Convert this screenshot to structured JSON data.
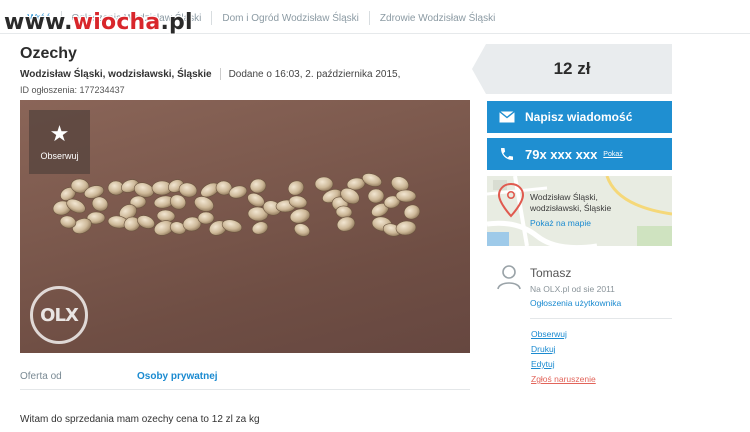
{
  "watermark": {
    "prefix": "www.",
    "brand": "wiocha",
    "suffix": ".pl"
  },
  "breadcrumb": {
    "back_label": "Wróć",
    "items": [
      "Ogłoszenia Wodzisław Śląski",
      "Dom i Ogród Wodzisław Śląski",
      "Zdrowie Wodzisław Śląski"
    ]
  },
  "ad": {
    "title": "Ozechy",
    "location": "Wodzisław Śląski, wodzisławski, Śląskie",
    "added": "Dodane o 16:03, 2. października 2015,",
    "id_label": "ID ogłoszenia: 177234437"
  },
  "photo": {
    "observe_label": "Obserwuj",
    "olx_logo_text": "OLX"
  },
  "offer": {
    "label": "Oferta od",
    "value": "Osoby prywatnej"
  },
  "description": "Witam do sprzedania mam ozechy cena to 12 zl za kg",
  "price": "12 zł",
  "buttons": {
    "message": "Napisz wiadomość",
    "phone": "79x xxx xxx",
    "phone_show": "Pokaż"
  },
  "map": {
    "address_line1": "Wodzisław Śląski,",
    "address_line2": "wodzisławski, Śląskie",
    "link": "Pokaż na mapie"
  },
  "user": {
    "name": "Tomasz",
    "since": "Na OLX.pl od sie 2011",
    "ads_link": "Ogłoszenia użytkownika"
  },
  "actions": [
    "Obserwuj",
    "Drukuj",
    "Edytuj",
    "Zgłoś naruszenie"
  ],
  "colors": {
    "accent": "#1f8fd1",
    "link": "#1a8ad0",
    "report": "#e2645a"
  }
}
